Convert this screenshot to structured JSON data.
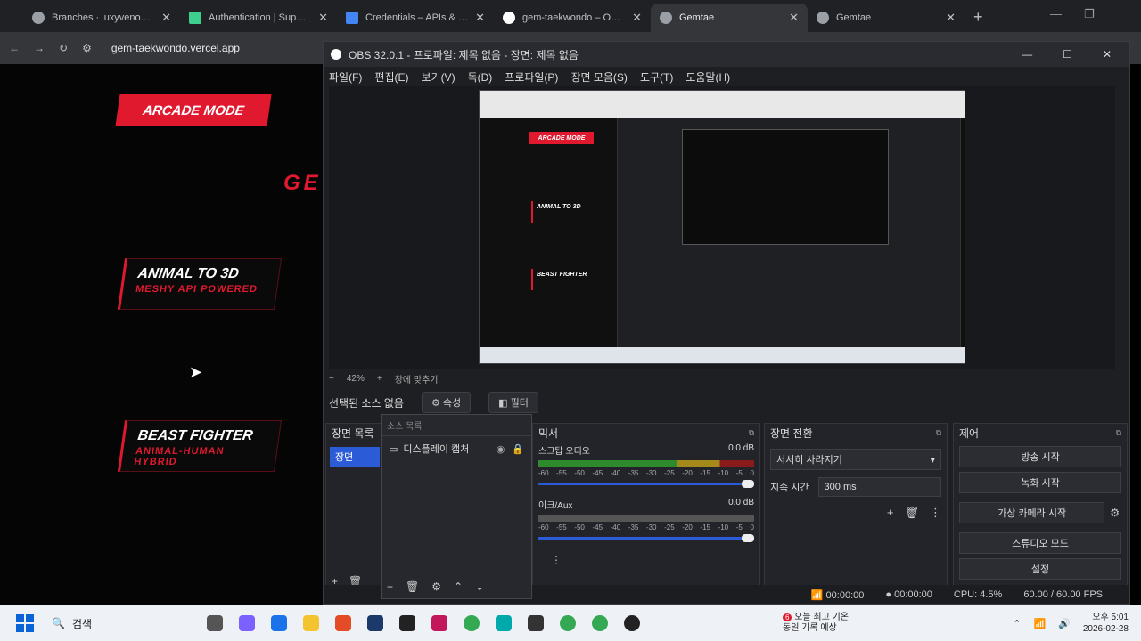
{
  "browser": {
    "tabs": [
      {
        "title": "Branches · luxyvenom/ge",
        "active": false
      },
      {
        "title": "Authentication | Supabase",
        "active": false
      },
      {
        "title": "Credentials – APIs & Serv",
        "active": false
      },
      {
        "title": "gem-taekwondo – Overvi",
        "active": false
      },
      {
        "title": "Gemtae",
        "active": true
      },
      {
        "title": "Gemtae",
        "active": false
      }
    ],
    "url": "gem-taekwondo.vercel.app"
  },
  "webpage": {
    "mode_badge": "ARCADE MODE",
    "partial_title": "GE",
    "cards": [
      {
        "heading": "ANIMAL TO 3D",
        "sub": "MESHY API POWERED"
      },
      {
        "heading": "BEAST FIGHTER",
        "sub": "ANIMAL-HUMAN HYBRID"
      }
    ]
  },
  "obs": {
    "window_title": "OBS 32.0.1 - 프로파일: 제목 없음 - 장면: 제목 없음",
    "menu": [
      "파일(F)",
      "편집(E)",
      "보기(V)",
      "독(D)",
      "프로파일(P)",
      "장면 모음(S)",
      "도구(T)",
      "도움말(H)"
    ],
    "zoom": "42%",
    "fit_label": "창에 맞추기",
    "no_source": "선택된 소스 없음",
    "properties_btn": "속성",
    "filters_btn": "필터",
    "scenes_title": "장면 목록",
    "scene_item": "장면",
    "sources_placeholder": "소스 목록",
    "source_item": "디스플레이 캡처",
    "mixer_title": "믹서",
    "channels": [
      {
        "name": "스크탑 오디오",
        "db": "0.0 dB"
      },
      {
        "name": "이크/Aux",
        "db": "0.0 dB"
      }
    ],
    "ticks": [
      "-60",
      "-55",
      "-50",
      "-45",
      "-40",
      "-35",
      "-30",
      "-25",
      "-20",
      "-15",
      "-10",
      "-5",
      "0"
    ],
    "transitions_title": "장면 전환",
    "transition_value": "서서히 사라지기",
    "duration_label": "지속 시간",
    "duration_value": "300 ms",
    "controls_title": "제어",
    "controls": [
      "방송 시작",
      "녹화 시작",
      "가상 카메라 시작",
      "스튜디오 모드",
      "설정"
    ],
    "status": {
      "stream_time": "00:00:00",
      "rec_time": "00:00:00",
      "cpu": "CPU: 4.5%",
      "fps": "60.00 / 60.00 FPS"
    }
  },
  "taskbar": {
    "search_label": "검색",
    "weather_line1": "오늘 최고 기온",
    "weather_line2": "동일 기록 예상",
    "badge": "6",
    "time": "오후 5:01",
    "date": "2026-02-28"
  }
}
